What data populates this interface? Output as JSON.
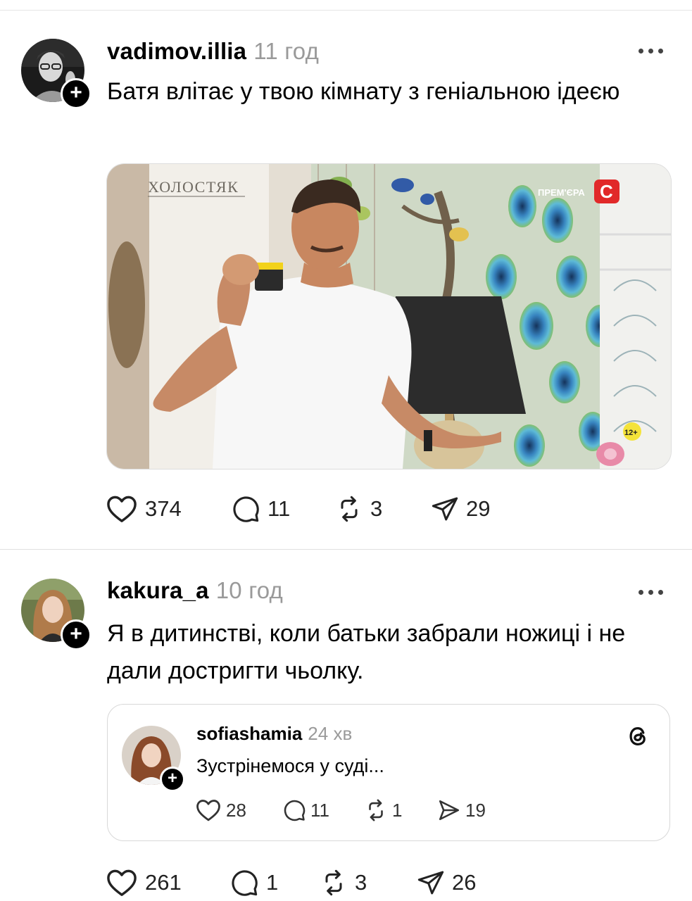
{
  "posts": [
    {
      "username": "vadimov.illia",
      "time": "11 год",
      "text": "Батя влітає у твою кімнату з геніальною ідеєю",
      "media": {
        "watermark": "ХОЛОСТЯК",
        "badge": "ПРЕМ'ЄРА",
        "channel": "C",
        "rating": "12+"
      },
      "actions": {
        "likes": "374",
        "comments": "11",
        "reposts": "3",
        "shares": "29"
      }
    },
    {
      "username": "kakura_a",
      "time": "10 год",
      "text": "Я в дитинстві, коли батьки забрали ножиці і не дали достригти чьолку.",
      "quote": {
        "username": "sofiashamia",
        "time": "24 хв",
        "text": "Зустрінемося у суді...",
        "actions": {
          "likes": "28",
          "comments": "11",
          "reposts": "1",
          "shares": "19"
        }
      },
      "actions": {
        "likes": "261",
        "comments": "1",
        "reposts": "3",
        "shares": "26"
      }
    }
  ],
  "icons": {
    "plus": "+",
    "more": "more-icon",
    "like": "heart-icon",
    "comment": "comment-icon",
    "repost": "repost-icon",
    "share": "share-icon",
    "threads": "threads-logo-icon"
  },
  "colors": {
    "text": "#000000",
    "muted": "#9a9a9a",
    "divider": "#e0e0e0"
  }
}
